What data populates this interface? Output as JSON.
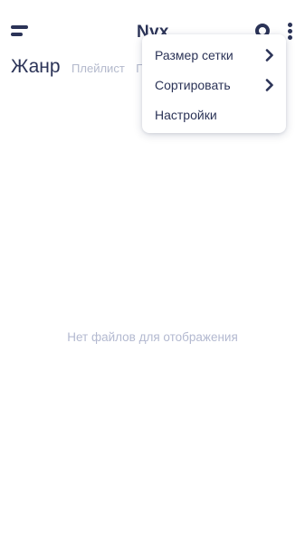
{
  "app_bar": {
    "title": "Nyx",
    "menu_icon": "hamburger-menu-icon",
    "search_icon": "search-icon",
    "more_icon": "more-vertical-icon"
  },
  "tabs": {
    "active": "Жанр",
    "items": [
      {
        "label": "Жанр",
        "active": true
      },
      {
        "label": "Плейлист",
        "active": false
      },
      {
        "label": "П",
        "active": false
      }
    ]
  },
  "empty_state": {
    "message": "Нет файлов для отображения"
  },
  "overflow_menu": {
    "items": [
      {
        "label": "Размер сетки",
        "has_submenu": true,
        "icon": "chevron-right-icon"
      },
      {
        "label": "Сортировать",
        "has_submenu": true,
        "icon": "chevron-right-icon"
      },
      {
        "label": "Настройки",
        "has_submenu": false
      }
    ]
  },
  "colors": {
    "primary_text": "#2b3357",
    "muted_text": "#b3b9cc",
    "background": "#ffffff"
  }
}
